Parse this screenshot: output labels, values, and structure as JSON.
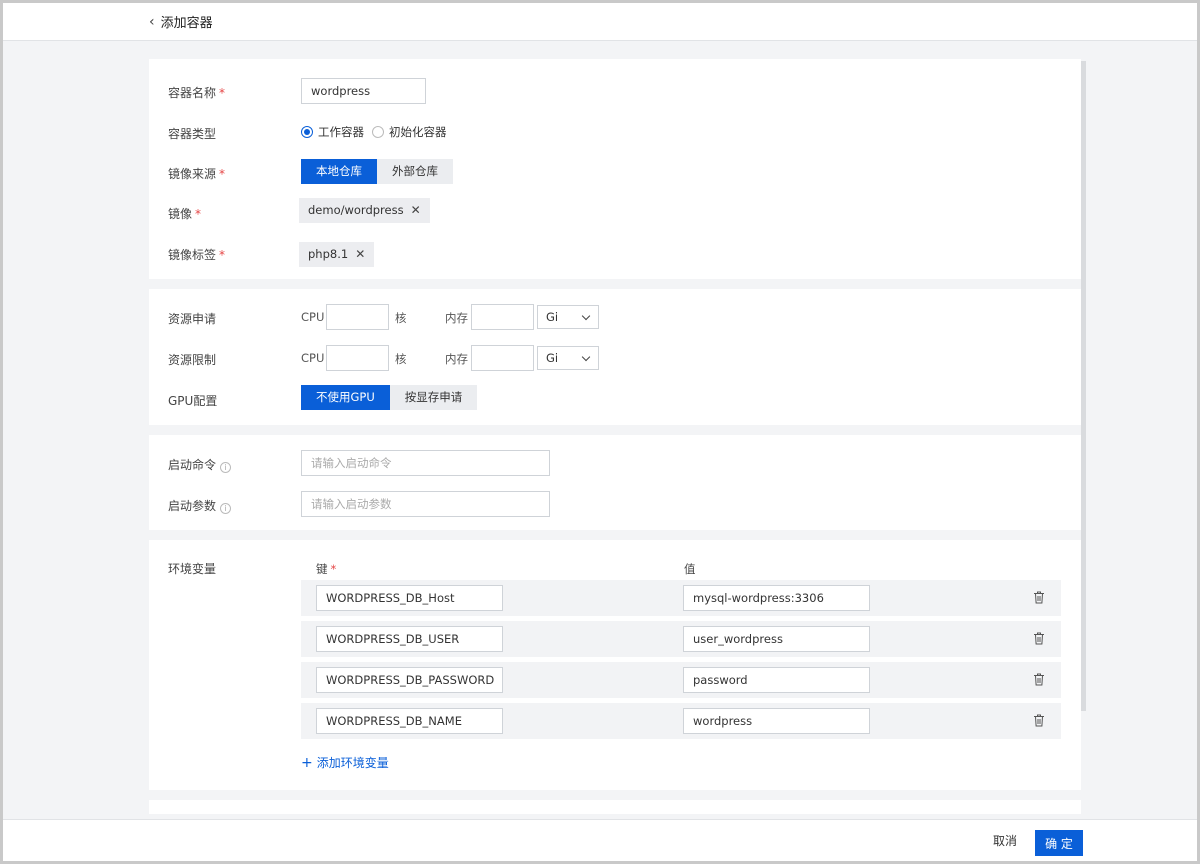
{
  "header": {
    "back_label": "添加容器"
  },
  "basic": {
    "name_label": "容器名称",
    "name_value": "wordpress",
    "type_label": "容器类型",
    "type_options": [
      "工作容器",
      "初始化容器"
    ],
    "source_label": "镜像来源",
    "source_options": [
      "本地仓库",
      "外部仓库"
    ],
    "image_label": "镜像",
    "image_value": "demo/wordpress",
    "tag_label": "镜像标签",
    "tag_value": "php8.1",
    "required_mark": "*",
    "remove_glyph": "✕"
  },
  "resources": {
    "request_label": "资源申请",
    "limit_label": "资源限制",
    "cpu_label": "CPU",
    "core_unit": "核",
    "memory_label": "内存",
    "memory_unit": "Gi",
    "gpu_label": "GPU配置",
    "gpu_options": [
      "不使用GPU",
      "按显存申请"
    ]
  },
  "startup": {
    "command_label": "启动命令",
    "command_placeholder": "请输入启动命令",
    "args_label": "启动参数",
    "args_placeholder": "请输入启动参数",
    "info_glyph": "i"
  },
  "env": {
    "label": "环境变量",
    "key_header": "键",
    "value_header": "值",
    "rows": [
      {
        "key": "WORDPRESS_DB_Host",
        "value": "mysql-wordpress:3306"
      },
      {
        "key": "WORDPRESS_DB_USER",
        "value": "user_wordpress"
      },
      {
        "key": "WORDPRESS_DB_PASSWORD",
        "value": "password"
      },
      {
        "key": "WORDPRESS_DB_NAME",
        "value": "wordpress"
      }
    ],
    "add_label": "添加环境变量",
    "add_glyph": "+"
  },
  "footer": {
    "cancel_label": "取消",
    "ok_label": "确 定"
  },
  "colors": {
    "primary": "#0a5fd8",
    "required": "#e54545"
  }
}
